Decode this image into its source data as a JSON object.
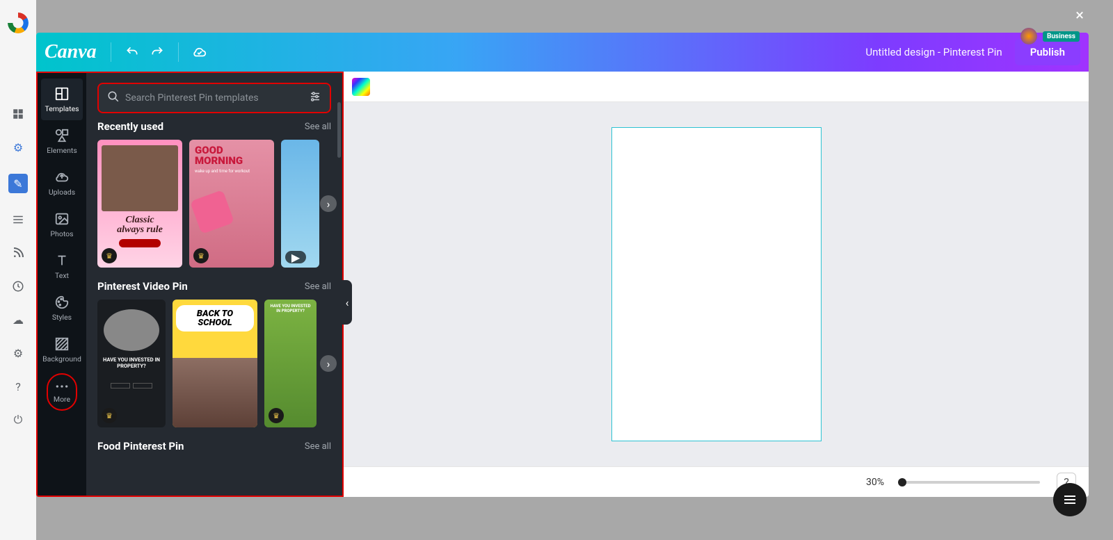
{
  "outer_strip": {
    "icons": [
      "grid",
      "gear",
      "edit",
      "list",
      "rss",
      "history",
      "cloud",
      "settings",
      "help",
      "power"
    ]
  },
  "close_label": "×",
  "business_badge": "Business",
  "topbar": {
    "logo": "Canva",
    "design_title": "Untitled design - Pinterest Pin",
    "publish": "Publish"
  },
  "side_toolbar": [
    {
      "id": "templates",
      "label": "Templates",
      "active": true
    },
    {
      "id": "elements",
      "label": "Elements"
    },
    {
      "id": "uploads",
      "label": "Uploads"
    },
    {
      "id": "photos",
      "label": "Photos"
    },
    {
      "id": "text",
      "label": "Text"
    },
    {
      "id": "styles",
      "label": "Styles"
    },
    {
      "id": "background",
      "label": "Background"
    },
    {
      "id": "more",
      "label": "More"
    }
  ],
  "search": {
    "placeholder": "Search Pinterest Pin templates"
  },
  "sections": {
    "recent": {
      "title": "Recently used",
      "see_all": "See all"
    },
    "video": {
      "title": "Pinterest Video Pin",
      "see_all": "See all"
    },
    "food": {
      "title": "Food Pinterest Pin",
      "see_all": "See all"
    }
  },
  "templates": {
    "recent": [
      {
        "id": "classic",
        "line1": "Classic",
        "line2": "always rule",
        "crown": true
      },
      {
        "id": "morning",
        "line1": "GOOD",
        "line2": "MORNING",
        "sub": "wake up and time for workout",
        "crown": true
      },
      {
        "id": "seattle",
        "play": true
      }
    ],
    "video": [
      {
        "id": "property",
        "line1": "HAVE YOU INVESTED IN PROPERTY?",
        "crown": true
      },
      {
        "id": "school",
        "line1": "BACK TO",
        "line2": "SCHOOL"
      },
      {
        "id": "green",
        "line1": "HAVE YOU INVESTED IN PROPERTY?",
        "crown": true
      }
    ]
  },
  "bottom": {
    "zoom": "30%"
  }
}
